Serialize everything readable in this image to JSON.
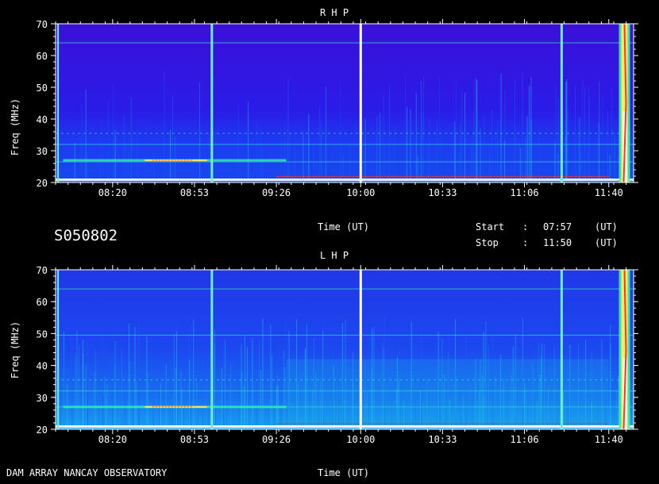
{
  "header": {
    "id_label": "S050802",
    "time_axis_label": "Time (UT)",
    "start_label": "Start",
    "start_sep": ":",
    "start_value": "07:57",
    "start_unit": "(UT)",
    "stop_label": "Stop",
    "stop_sep": ":",
    "stop_value": "11:50",
    "stop_unit": "(UT)"
  },
  "footer": {
    "instrument": "DAM ARRAY  NANCAY OBSERVATORY",
    "time_axis_label": "Time (UT)"
  },
  "chart_data": [
    {
      "type": "heatmap",
      "title": "R H P",
      "xlabel": "Time (UT)",
      "ylabel": "Freq (MHz)",
      "xlim": [
        "07:57",
        "11:50"
      ],
      "ylim": [
        20,
        70
      ],
      "x_ticks": [
        "08:20",
        "08:53",
        "09:26",
        "10:00",
        "10:33",
        "11:06",
        "11:40"
      ],
      "y_ticks": [
        20,
        30,
        40,
        50,
        60,
        70
      ],
      "vertical_lines": [
        "07:58",
        "09:00",
        "10:00",
        "11:21",
        "11:46"
      ],
      "horizontal_bands_mhz": [
        64,
        35.5,
        32,
        26.5,
        21
      ],
      "burst": {
        "time": "11:46",
        "freq_range": [
          20,
          70
        ]
      },
      "colors": [
        "#1400a0",
        "#3a18e0",
        "#1a3cf0",
        "#1aa0f0",
        "#2af0d0",
        "#a0f060",
        "#ff3030",
        "#ffffff"
      ]
    },
    {
      "type": "heatmap",
      "title": "L H P",
      "xlabel": "Time (UT)",
      "ylabel": "Freq (MHz)",
      "xlim": [
        "07:57",
        "11:50"
      ],
      "ylim": [
        20,
        70
      ],
      "x_ticks": [
        "08:20",
        "08:53",
        "09:26",
        "10:00",
        "10:33",
        "11:06",
        "11:40"
      ],
      "y_ticks": [
        20,
        30,
        40,
        50,
        60,
        70
      ],
      "vertical_lines": [
        "07:58",
        "09:00",
        "10:00",
        "11:21",
        "11:46"
      ],
      "horizontal_bands_mhz": [
        64,
        49.5,
        35.5,
        32,
        27,
        21
      ],
      "burst": {
        "time": "11:46",
        "freq_range": [
          20,
          70
        ]
      },
      "colors": [
        "#1400a0",
        "#3a18e0",
        "#1a3cf0",
        "#1aa0f0",
        "#2af0d0",
        "#a0f060",
        "#ff3030",
        "#ffffff"
      ]
    }
  ]
}
